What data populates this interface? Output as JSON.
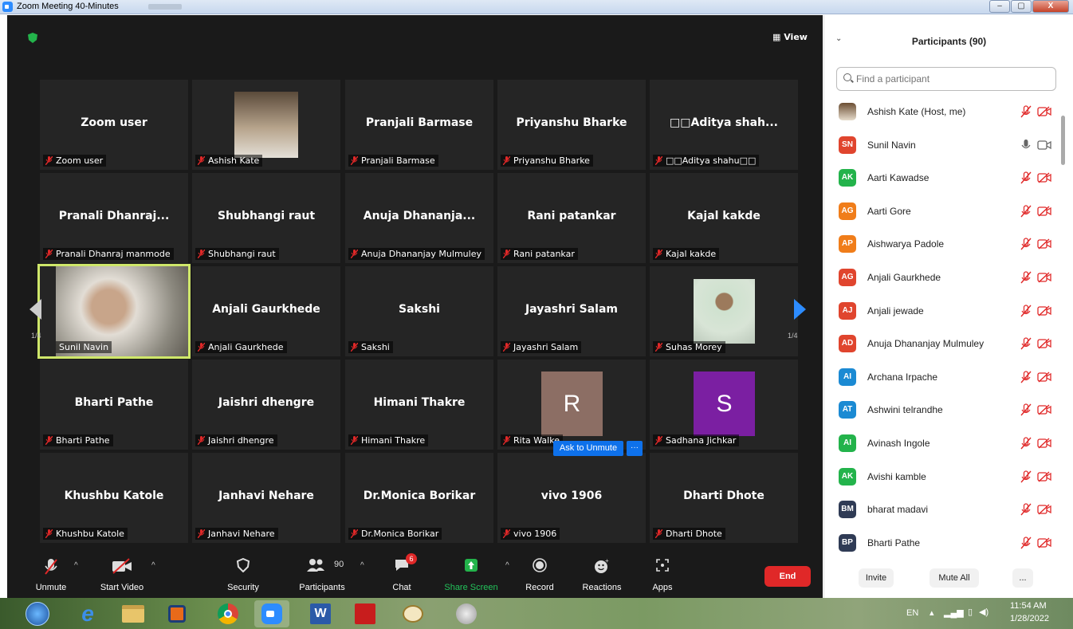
{
  "window": {
    "title": "Zoom Meeting 40-Minutes",
    "min": "–",
    "max": "▢",
    "close": "X"
  },
  "top": {
    "view_label": "View"
  },
  "tiles": [
    {
      "display": "Zoom user",
      "label": "Zoom user"
    },
    {
      "display": "",
      "label": "Ashish Kate"
    },
    {
      "display": "Pranjali Barmase",
      "label": "Pranjali Barmase"
    },
    {
      "display": "Priyanshu Bharke",
      "label": "Priyanshu Bharke"
    },
    {
      "display": "□□Aditya  shah...",
      "label": "□□Aditya  shahu□□"
    },
    {
      "display": "Pranali  Dhanraj...",
      "label": "Pranali Dhanraj manmode"
    },
    {
      "display": "Shubhangi raut",
      "label": "Shubhangi raut"
    },
    {
      "display": "Anuja  Dhananja...",
      "label": "Anuja Dhananjay Mulmuley"
    },
    {
      "display": "Rani patankar",
      "label": "Rani patankar"
    },
    {
      "display": "Kajal  kakde",
      "label": "Kajal  kakde"
    },
    {
      "display": "",
      "label": "Sunil Navin"
    },
    {
      "display": "Anjali Gaurkhede",
      "label": "Anjali Gaurkhede"
    },
    {
      "display": "Sakshi",
      "label": "Sakshi"
    },
    {
      "display": "Jayashri Salam",
      "label": "Jayashri Salam"
    },
    {
      "display": "",
      "label": "Suhas Morey"
    },
    {
      "display": "Bharti Pathe",
      "label": "Bharti Pathe"
    },
    {
      "display": "Jaishri dhengre",
      "label": "Jaishri dhengre"
    },
    {
      "display": "Himani Thakre",
      "label": "Himani Thakre"
    },
    {
      "display": "R",
      "label": "Rita Walke"
    },
    {
      "display": "S",
      "label": "Sadhana Jichkar"
    },
    {
      "display": "Khushbu Katole",
      "label": "Khushbu Katole"
    },
    {
      "display": "Janhavi Nehare",
      "label": "Janhavi Nehare"
    },
    {
      "display": "Dr.Monica Borikar",
      "label": "Dr.Monica Borikar"
    },
    {
      "display": "vivo 1906",
      "label": "vivo 1906"
    },
    {
      "display": "Dharti Dhote",
      "label": "Dharti Dhote"
    }
  ],
  "pager": {
    "left": "1/4",
    "right": "1/4"
  },
  "ask_unmute": {
    "label": "Ask to Unmute",
    "more": "···"
  },
  "toolbar": {
    "unmute": "Unmute",
    "start_video": "Start Video",
    "security": "Security",
    "participants": "Participants",
    "participants_count": "90",
    "chat": "Chat",
    "chat_badge": "6",
    "share": "Share Screen",
    "record": "Record",
    "reactions": "Reactions",
    "apps": "Apps",
    "end": "End"
  },
  "panel": {
    "title": "Participants (90)",
    "search_placeholder": "Find a participant",
    "invite": "Invite",
    "mute_all": "Mute All",
    "more": "...",
    "participants": [
      {
        "initials": "",
        "name": "Ashish Kate (Host, me)",
        "color": "#7a5c3e",
        "muted": true,
        "video": false
      },
      {
        "initials": "SN",
        "name": "Sunil Navin",
        "color": "#e0452e",
        "muted": false,
        "video": true
      },
      {
        "initials": "AK",
        "name": "Aarti  Kawadse",
        "color": "#23b34b",
        "muted": true,
        "video": false
      },
      {
        "initials": "AG",
        "name": "Aarti Gore",
        "color": "#f07d1a",
        "muted": true,
        "video": false
      },
      {
        "initials": "AP",
        "name": "Aishwarya Padole",
        "color": "#f07d1a",
        "muted": true,
        "video": false
      },
      {
        "initials": "AG",
        "name": "Anjali Gaurkhede",
        "color": "#e0452e",
        "muted": true,
        "video": false
      },
      {
        "initials": "AJ",
        "name": "Anjali jewade",
        "color": "#e0452e",
        "muted": true,
        "video": false
      },
      {
        "initials": "AD",
        "name": "Anuja Dhananjay Mulmuley",
        "color": "#e0452e",
        "muted": true,
        "video": false
      },
      {
        "initials": "AI",
        "name": "Archana Irpache",
        "color": "#1b8ad3",
        "muted": true,
        "video": false
      },
      {
        "initials": "AT",
        "name": "Ashwini telrandhe",
        "color": "#1b8ad3",
        "muted": true,
        "video": false
      },
      {
        "initials": "AI",
        "name": "Avinash Ingole",
        "color": "#23b34b",
        "muted": true,
        "video": false
      },
      {
        "initials": "AK",
        "name": "Avishi kamble",
        "color": "#23b34b",
        "muted": true,
        "video": false
      },
      {
        "initials": "BM",
        "name": "bharat madavi",
        "color": "#2f3b55",
        "muted": true,
        "video": false
      },
      {
        "initials": "BP",
        "name": "Bharti Pathe",
        "color": "#2f3b55",
        "muted": true,
        "video": false
      }
    ]
  },
  "tray": {
    "lang": "EN",
    "time": "11:54 AM",
    "date": "1/28/2022"
  }
}
